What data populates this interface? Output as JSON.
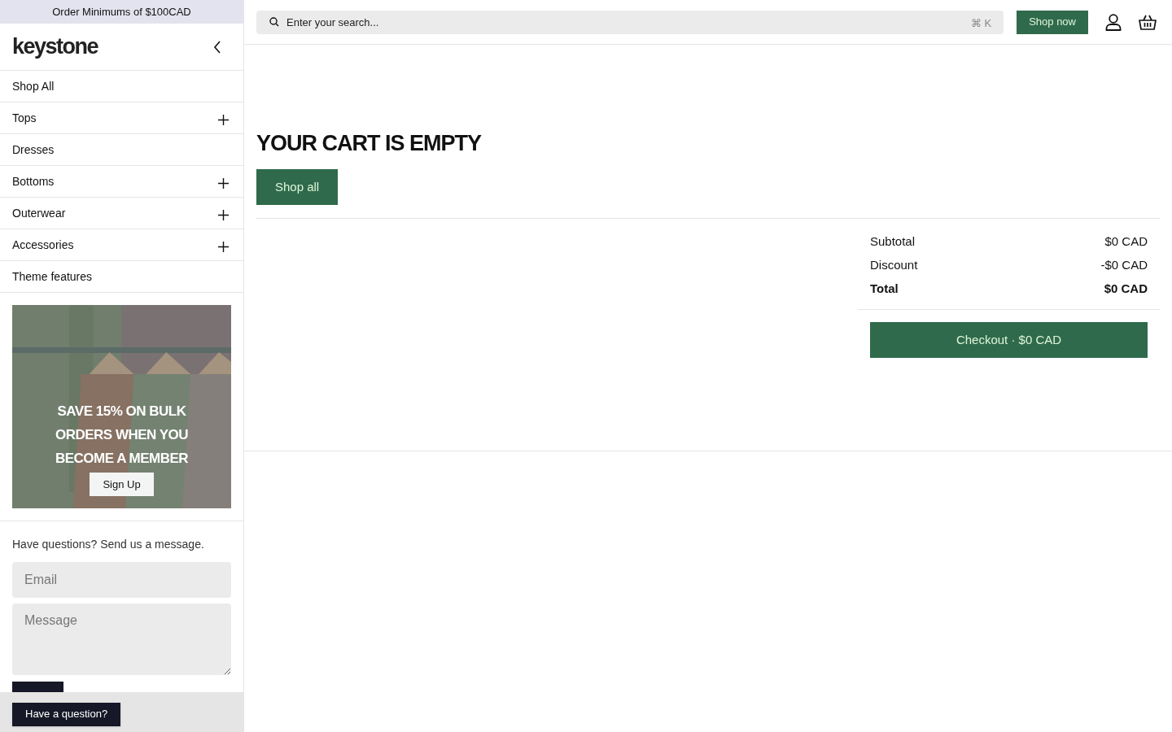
{
  "announcement": "Order Minimums of $100CAD",
  "sidebar": {
    "logo": "keystone",
    "nav": [
      {
        "label": "Shop All",
        "expandable": false
      },
      {
        "label": "Tops",
        "expandable": true
      },
      {
        "label": "Dresses",
        "expandable": false
      },
      {
        "label": "Bottoms",
        "expandable": true
      },
      {
        "label": "Outerwear",
        "expandable": true
      },
      {
        "label": "Accessories",
        "expandable": true
      },
      {
        "label": "Theme features",
        "expandable": false
      }
    ],
    "promo": {
      "kind": "picture",
      "heading": "SAVE 15% ON BULK ORDERS WHEN YOU BECOME A MEMBER",
      "button": "Sign Up"
    },
    "contact": {
      "prompt": "Have questions? Send us a message.",
      "email_placeholder": "Email",
      "message_placeholder": "Message"
    },
    "chat_button": "Have a question?"
  },
  "header": {
    "search": {
      "placeholder": "Enter your search...",
      "shortcut": "⌘ K"
    },
    "shop_now": "Shop now"
  },
  "cart": {
    "title": "YOUR CART IS EMPTY",
    "button": "Shop all",
    "summary": [
      {
        "kind": "line",
        "label": "Subtotal",
        "value": "$0 CAD"
      },
      {
        "kind": "line",
        "label": "Discount",
        "value": "-$0 CAD"
      },
      {
        "kind": "total",
        "label": "Total",
        "value": "$0 CAD"
      }
    ],
    "checkout": "Checkout · $0 CAD"
  }
}
